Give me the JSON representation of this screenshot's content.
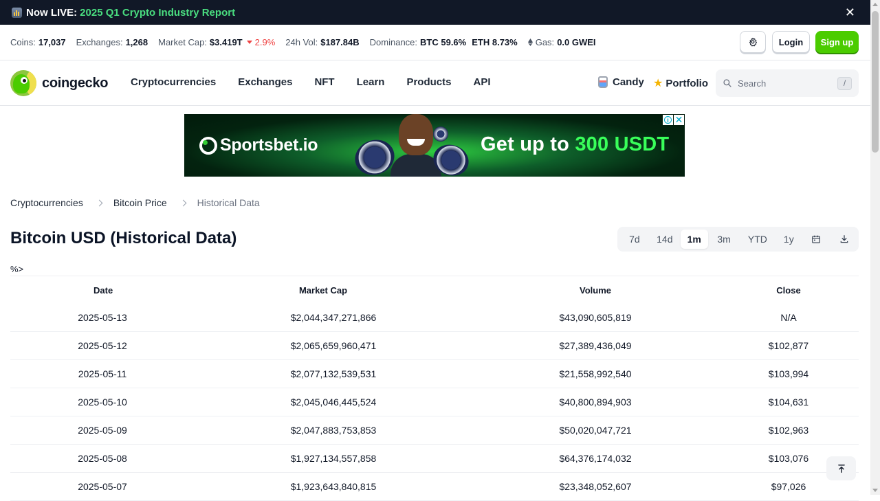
{
  "announcement": {
    "lead": "Now LIVE:",
    "link": "2025 Q1 Crypto Industry Report",
    "close_glyph": "✕"
  },
  "stats": {
    "coins_label": "Coins:",
    "coins_value": "17,037",
    "exchanges_label": "Exchanges:",
    "exchanges_value": "1,268",
    "market_cap_label": "Market Cap:",
    "market_cap_value": "$3.419T",
    "market_cap_change": "2.9%",
    "volume_label": "24h Vol:",
    "volume_value": "$187.84B",
    "dominance_label": "Dominance:",
    "dominance_btc": "BTC 59.6%",
    "dominance_eth": "ETH 8.73%",
    "gas_label": "Gas:",
    "gas_value": "0.0 GWEI"
  },
  "auth": {
    "login": "Login",
    "signup": "Sign up"
  },
  "logo": {
    "word": "coingecko"
  },
  "nav": {
    "items": [
      "Cryptocurrencies",
      "Exchanges",
      "NFT",
      "Learn",
      "Products",
      "API"
    ],
    "candy": "Candy",
    "portfolio": "Portfolio"
  },
  "search": {
    "placeholder": "Search",
    "shortcut": "/"
  },
  "ad": {
    "brand": "Sportsbet.io",
    "headline_prefix": "Get up to ",
    "headline_highlight": "300 USDT",
    "info_glyph": "i",
    "close_glyph": "✕"
  },
  "breadcrumb": [
    "Cryptocurrencies",
    "Bitcoin Price",
    "Historical Data"
  ],
  "page_title": "Bitcoin USD (Historical Data)",
  "ranges": {
    "items": [
      "7d",
      "14d",
      "1m",
      "3m",
      "YTD",
      "1y"
    ],
    "active": "1m"
  },
  "stray_text": "%>",
  "table": {
    "headers": [
      "Date",
      "Market Cap",
      "Volume",
      "Close"
    ],
    "rows": [
      [
        "2025-05-13",
        "$2,044,347,271,866",
        "$43,090,605,819",
        "N/A"
      ],
      [
        "2025-05-12",
        "$2,065,659,960,471",
        "$27,389,436,049",
        "$102,877"
      ],
      [
        "2025-05-11",
        "$2,077,132,539,531",
        "$21,558,992,540",
        "$103,994"
      ],
      [
        "2025-05-10",
        "$2,045,046,445,524",
        "$40,800,894,903",
        "$104,631"
      ],
      [
        "2025-05-09",
        "$2,047,883,753,853",
        "$50,020,047,721",
        "$102,963"
      ],
      [
        "2025-05-08",
        "$1,927,134,557,858",
        "$64,376,174,032",
        "$103,076"
      ],
      [
        "2025-05-07",
        "$1,923,643,840,815",
        "$23,348,052,607",
        "$97,026"
      ]
    ]
  },
  "icons": {
    "report": "bar-chart-icon",
    "close": "close-icon",
    "settings": "gear-icon",
    "eth": "ethereum-icon",
    "search": "search-icon",
    "calendar": "calendar-icon",
    "download": "download-icon",
    "scroll_top": "arrow-up-to-line-icon"
  },
  "colors": {
    "accent": "#4bcc00",
    "negative": "#ef4444",
    "link_green": "#4ade80"
  }
}
